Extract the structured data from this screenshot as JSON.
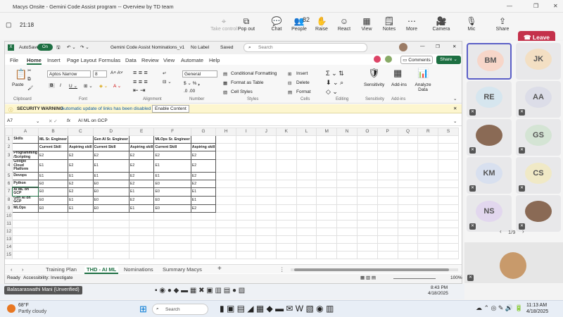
{
  "window": {
    "title": "Macys Onsite - Gemini Code Assist program -- Overview by TD team"
  },
  "meeting": {
    "timer": "21:18",
    "participants_count": "82",
    "leave_label": "Leave",
    "buttons": [
      {
        "name": "take-control",
        "label": "Take control",
        "icon": "⌖"
      },
      {
        "name": "pop-out",
        "label": "Pop out",
        "icon": "⧉"
      },
      {
        "name": "chat",
        "label": "Chat",
        "icon": "💬"
      },
      {
        "name": "people",
        "label": "People",
        "icon": "👥"
      },
      {
        "name": "raise",
        "label": "Raise",
        "icon": "✋"
      },
      {
        "name": "react",
        "label": "React",
        "icon": "☺"
      },
      {
        "name": "view",
        "label": "View",
        "icon": "▦"
      },
      {
        "name": "notes",
        "label": "Notes",
        "icon": "🗒"
      },
      {
        "name": "more",
        "label": "More",
        "icon": "⋯"
      },
      {
        "name": "camera",
        "label": "Camera",
        "icon": "🎥"
      },
      {
        "name": "mic",
        "label": "Mic",
        "icon": "🎙"
      },
      {
        "name": "share",
        "label": "Share",
        "icon": "⇪"
      }
    ]
  },
  "excel": {
    "autosave": "AutoSave",
    "autosave_state": "On",
    "filename": "Gemini Code Assist Nominations_v1",
    "label": "No Label",
    "saved": "Saved",
    "search_placeholder": "Search",
    "menu": [
      "File",
      "Home",
      "Insert",
      "Page Layout",
      "Formulas",
      "Data",
      "Review",
      "View",
      "Automate",
      "Help"
    ],
    "comments": "Comments",
    "share": "Share",
    "ribbon": {
      "paste": "Paste",
      "clipboard": "Clipboard",
      "font_name": "Aptos Narrow",
      "font_size": "8",
      "font": "Font",
      "alignment": "Alignment",
      "number_format": "General",
      "number": "Number",
      "cond_fmt": "Conditional Formatting",
      "fmt_table": "Format as Table",
      "cell_styles": "Cell Styles",
      "styles": "Styles",
      "insert": "Insert",
      "delete": "Delete",
      "format": "Format",
      "cells": "Cells",
      "editing": "Editing",
      "sensitivity": "Sensitivity",
      "addins": "Add-ins",
      "analyze": "Analyze Data"
    },
    "security_title": "SECURITY WARNING",
    "security_msg": "Automatic update of links has been disabled",
    "enable_content": "Enable Content",
    "name_box": "A7",
    "formula": "AI ML on GCP",
    "columns": [
      "A",
      "B",
      "C",
      "D",
      "E",
      "F",
      "G",
      "H",
      "I",
      "J",
      "K",
      "L",
      "M",
      "N",
      "O",
      "P",
      "Q",
      "R",
      "S"
    ],
    "rows": [
      [
        "Skills",
        "ML Sr. Engineer",
        "",
        "Gen AI Sr. Engineer",
        "",
        "MLOps Sr. Engineer",
        ""
      ],
      [
        "",
        "Current Skill",
        "Aspiring skill",
        "Current Skill",
        "Aspiring skill",
        "Current Skill",
        "Aspiring skill"
      ],
      [
        "Programming /Scripting",
        "E2",
        "E2",
        "E2",
        "E2",
        "E2",
        "E2"
      ],
      [
        "Google Cloud Platform",
        "E1",
        "E2",
        "E1",
        "E2",
        "E1",
        "E2"
      ],
      [
        "Devops",
        "E1",
        "E1",
        "E1",
        "E2",
        "E1",
        "E2"
      ],
      [
        "Python",
        "E0",
        "E2",
        "E0",
        "E2",
        "E0",
        "E2"
      ],
      [
        "AI ML on GCP",
        "E0",
        "E2",
        "E0",
        "E1",
        "E0",
        "E1"
      ],
      [
        "Gen AI on GCP",
        "E0",
        "E1",
        "E0",
        "E2",
        "E0",
        "E1"
      ],
      [
        "MLOps",
        "E0",
        "E1",
        "E0",
        "E1",
        "E0",
        "E2"
      ],
      [
        "",
        "",
        "",
        "",
        "",
        "",
        ""
      ],
      [
        "",
        "",
        "",
        "",
        "",
        "",
        ""
      ],
      [
        "",
        "",
        "",
        "",
        "",
        "",
        ""
      ],
      [
        "",
        "",
        "",
        "",
        "",
        "",
        ""
      ],
      [
        "",
        "",
        "",
        "",
        "",
        "",
        ""
      ],
      [
        "",
        "",
        "",
        "",
        "",
        "",
        ""
      ]
    ],
    "sheets": [
      "Training Plan",
      "THD - AI ML",
      "Nominations",
      "Summary Macys"
    ],
    "status_ready": "Ready",
    "accessibility": "Accessibility: Investigate",
    "zoom": "100%"
  },
  "participants": [
    {
      "initials": "BM",
      "color": "#f7d6c9"
    },
    {
      "initials": "JK",
      "color": "#f3dfc3"
    },
    {
      "initials": "RE",
      "color": "#d6e6ef"
    },
    {
      "initials": "AA",
      "color": "#dcdde8"
    },
    {
      "initials": "",
      "color": "#cfcfcf"
    },
    {
      "initials": "GS",
      "color": "#d4e4d4"
    },
    {
      "initials": "KM",
      "color": "#d8e0ef"
    },
    {
      "initials": "CS",
      "color": "#f0e9c6"
    },
    {
      "initials": "NS",
      "color": "#e2d7ee"
    },
    {
      "initials": "",
      "color": "#cfcfcf"
    }
  ],
  "pager": "1/9",
  "screen_share_user": "Balasaraswathi Mani (Unverified)",
  "taskbar": {
    "weather_temp": "68°F",
    "weather_desc": "Partly cloudy",
    "search": "Search",
    "time": "11:13 AM",
    "date": "4/18/2025",
    "inner_time": "8:43 PM",
    "inner_date": "4/18/2025"
  }
}
